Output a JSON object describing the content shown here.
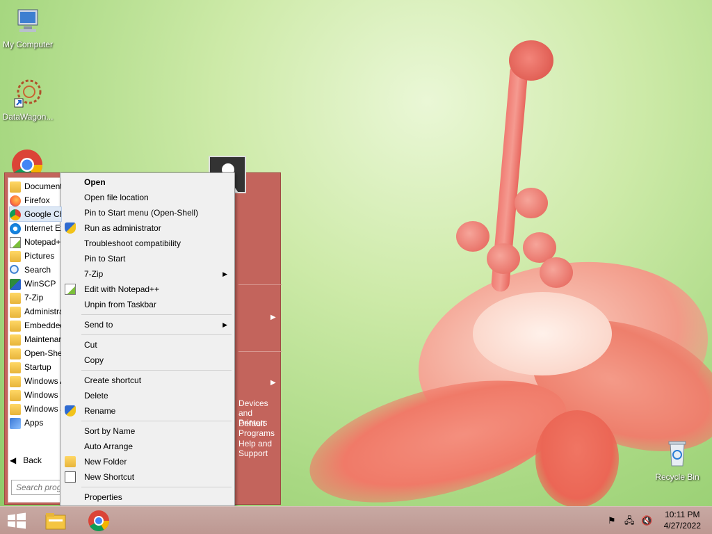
{
  "desktop": {
    "icons": [
      {
        "label": "My Computer"
      },
      {
        "label": "DataWagon..."
      },
      {
        "label": "Recycle Bin"
      }
    ]
  },
  "start_menu": {
    "programs": [
      {
        "label": "Documents",
        "icon": "folder-icon"
      },
      {
        "label": "Firefox",
        "icon": "firefox-icon"
      },
      {
        "label": "Google Chrome",
        "icon": "chrome-icon"
      },
      {
        "label": "Internet Explorer",
        "icon": "ie-icon"
      },
      {
        "label": "Notepad++",
        "icon": "notepad-icon"
      },
      {
        "label": "Pictures",
        "icon": "folder-icon"
      },
      {
        "label": "Search",
        "icon": "search-icon"
      },
      {
        "label": "WinSCP",
        "icon": "winscp-icon"
      },
      {
        "label": "7-Zip",
        "icon": "folder-icon"
      },
      {
        "label": "Administrative Tools",
        "icon": "folder-icon"
      },
      {
        "label": "Embedded Lockdown Manager",
        "icon": "folder-icon"
      },
      {
        "label": "Maintenance",
        "icon": "folder-icon"
      },
      {
        "label": "Open-Shell",
        "icon": "folder-icon"
      },
      {
        "label": "Startup",
        "icon": "folder-icon"
      },
      {
        "label": "Windows Accessories",
        "icon": "folder-icon"
      },
      {
        "label": "Windows Ease of Access",
        "icon": "folder-icon"
      },
      {
        "label": "Windows System",
        "icon": "folder-icon"
      },
      {
        "label": "Apps",
        "icon": "apps-icon"
      }
    ],
    "back_label": "Back",
    "search_placeholder": "Search programs and files",
    "right_items": [
      {
        "label": "Devices and Printers"
      },
      {
        "label": "Default Programs"
      },
      {
        "label": "Help and Support"
      }
    ]
  },
  "context_menu": {
    "items": [
      {
        "label": "Open",
        "bold": true
      },
      {
        "label": "Open file location"
      },
      {
        "label": "Pin to Start menu (Open-Shell)"
      },
      {
        "label": "Run as administrator",
        "icon": "shield-icon"
      },
      {
        "label": "Troubleshoot compatibility"
      },
      {
        "label": "Pin to Start"
      },
      {
        "label": "7-Zip",
        "submenu": true
      },
      {
        "label": "Edit with Notepad++",
        "icon": "notepad-icon"
      },
      {
        "label": "Unpin from Taskbar"
      },
      {
        "label": "Send to",
        "submenu": true
      },
      {
        "label": "Cut"
      },
      {
        "label": "Copy"
      },
      {
        "label": "Create shortcut"
      },
      {
        "label": "Delete"
      },
      {
        "label": "Rename",
        "icon": "shield-icon"
      },
      {
        "label": "Sort by Name"
      },
      {
        "label": "Auto Arrange"
      },
      {
        "label": "New Folder",
        "icon": "folder-icon"
      },
      {
        "label": "New Shortcut",
        "icon": "shortcut-icon"
      },
      {
        "label": "Properties"
      }
    ]
  },
  "taskbar": {
    "time": "10:11 PM",
    "date": "4/27/2022"
  }
}
